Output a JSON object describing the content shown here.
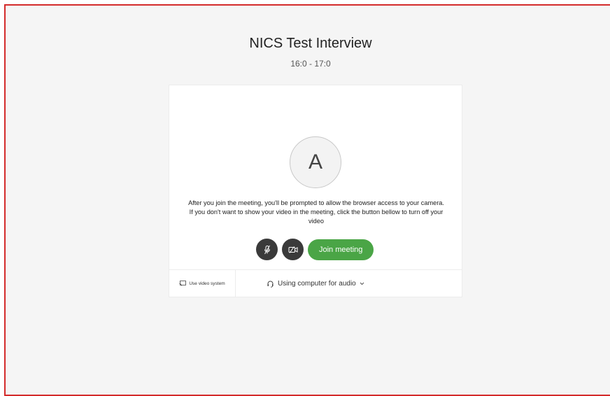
{
  "meeting": {
    "title": "NICS Test Interview",
    "time": "16:0 - 17:0"
  },
  "preview": {
    "avatar_letter": "A",
    "message": "After you join the meeting, you'll be prompted to allow the browser access to your camera. If you don't want to show your video in the meeting, click the button bellow to turn off your video"
  },
  "controls": {
    "mute_icon": "mic-off-icon",
    "video_icon": "video-off-icon",
    "join_label": "Join meeting"
  },
  "footer": {
    "video_system_label": "Use video system",
    "audio_label": "Using computer for audio"
  },
  "colors": {
    "join_green": "#4aa546",
    "dark_button": "#3a3a3a",
    "frame_red": "#d42b2b"
  }
}
